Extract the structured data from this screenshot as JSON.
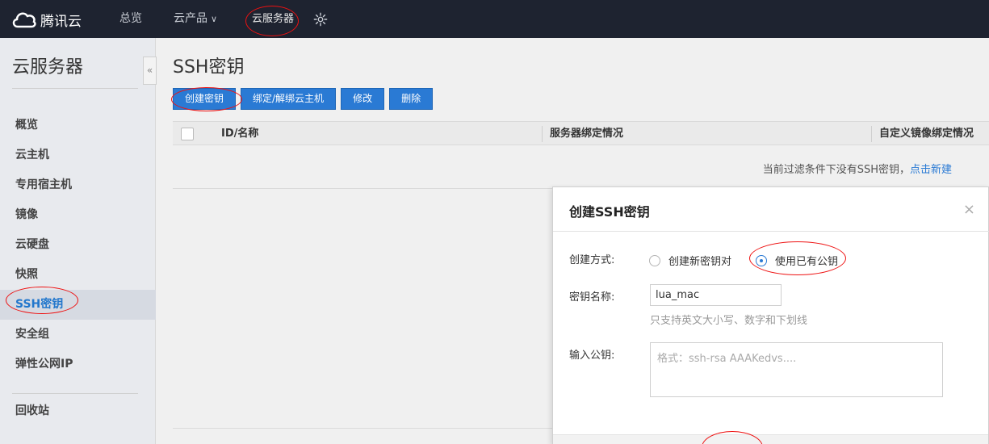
{
  "topbar": {
    "logo_text": "腾讯云",
    "nav": {
      "overview": "总览",
      "products": "云产品",
      "cvm": "云服务器"
    }
  },
  "sidebar": {
    "title": "云服务器",
    "items": [
      {
        "label": "概览"
      },
      {
        "label": "云主机"
      },
      {
        "label": "专用宿主机"
      },
      {
        "label": "镜像"
      },
      {
        "label": "云硬盘"
      },
      {
        "label": "快照"
      },
      {
        "label": "SSH密钥",
        "active": true
      },
      {
        "label": "安全组"
      },
      {
        "label": "弹性公网IP"
      },
      {
        "label": "回收站"
      }
    ]
  },
  "main": {
    "title": "SSH密钥",
    "toolbar": {
      "create": "创建密钥",
      "bind": "绑定/解绑云主机",
      "edit": "修改",
      "delete": "删除"
    },
    "table": {
      "columns": [
        "ID/名称",
        "服务器绑定情况",
        "自定义镜像绑定情况"
      ],
      "empty_text": "当前过滤条件下没有SSH密钥，",
      "empty_link": "点击新建"
    }
  },
  "dialog": {
    "title": "创建SSH密钥",
    "close": "×",
    "method_label": "创建方式:",
    "method_options": [
      "创建新密钥对",
      "使用已有公钥"
    ],
    "method_selected": "使用已有公钥",
    "name_label": "密钥名称:",
    "name_value": "lua_mac",
    "name_hint": "只支持英文大小写、数字和下划线",
    "pubkey_label": "输入公钥:",
    "pubkey_placeholder": "格式：ssh-rsa AAAKedvs...."
  },
  "colors": {
    "topbar_bg": "#1e2330",
    "primary": "#2a7ad4",
    "annotation": "#ee1111"
  }
}
